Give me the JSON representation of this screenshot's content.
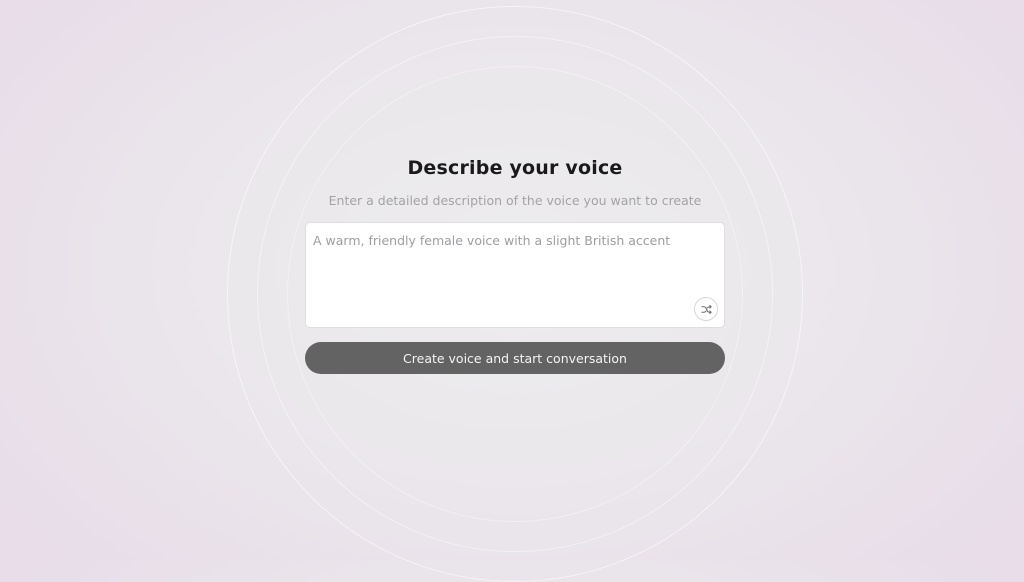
{
  "form": {
    "title": "Describe your voice",
    "subtitle": "Enter a detailed description of the voice you want to create",
    "description_placeholder": "A warm, friendly female voice with a slight British accent",
    "description_value": "",
    "shuffle_icon": "shuffle-icon",
    "submit_label": "Create voice and start conversation"
  },
  "colors": {
    "button_bg": "#636363",
    "background_tint": "#e8dde9"
  }
}
